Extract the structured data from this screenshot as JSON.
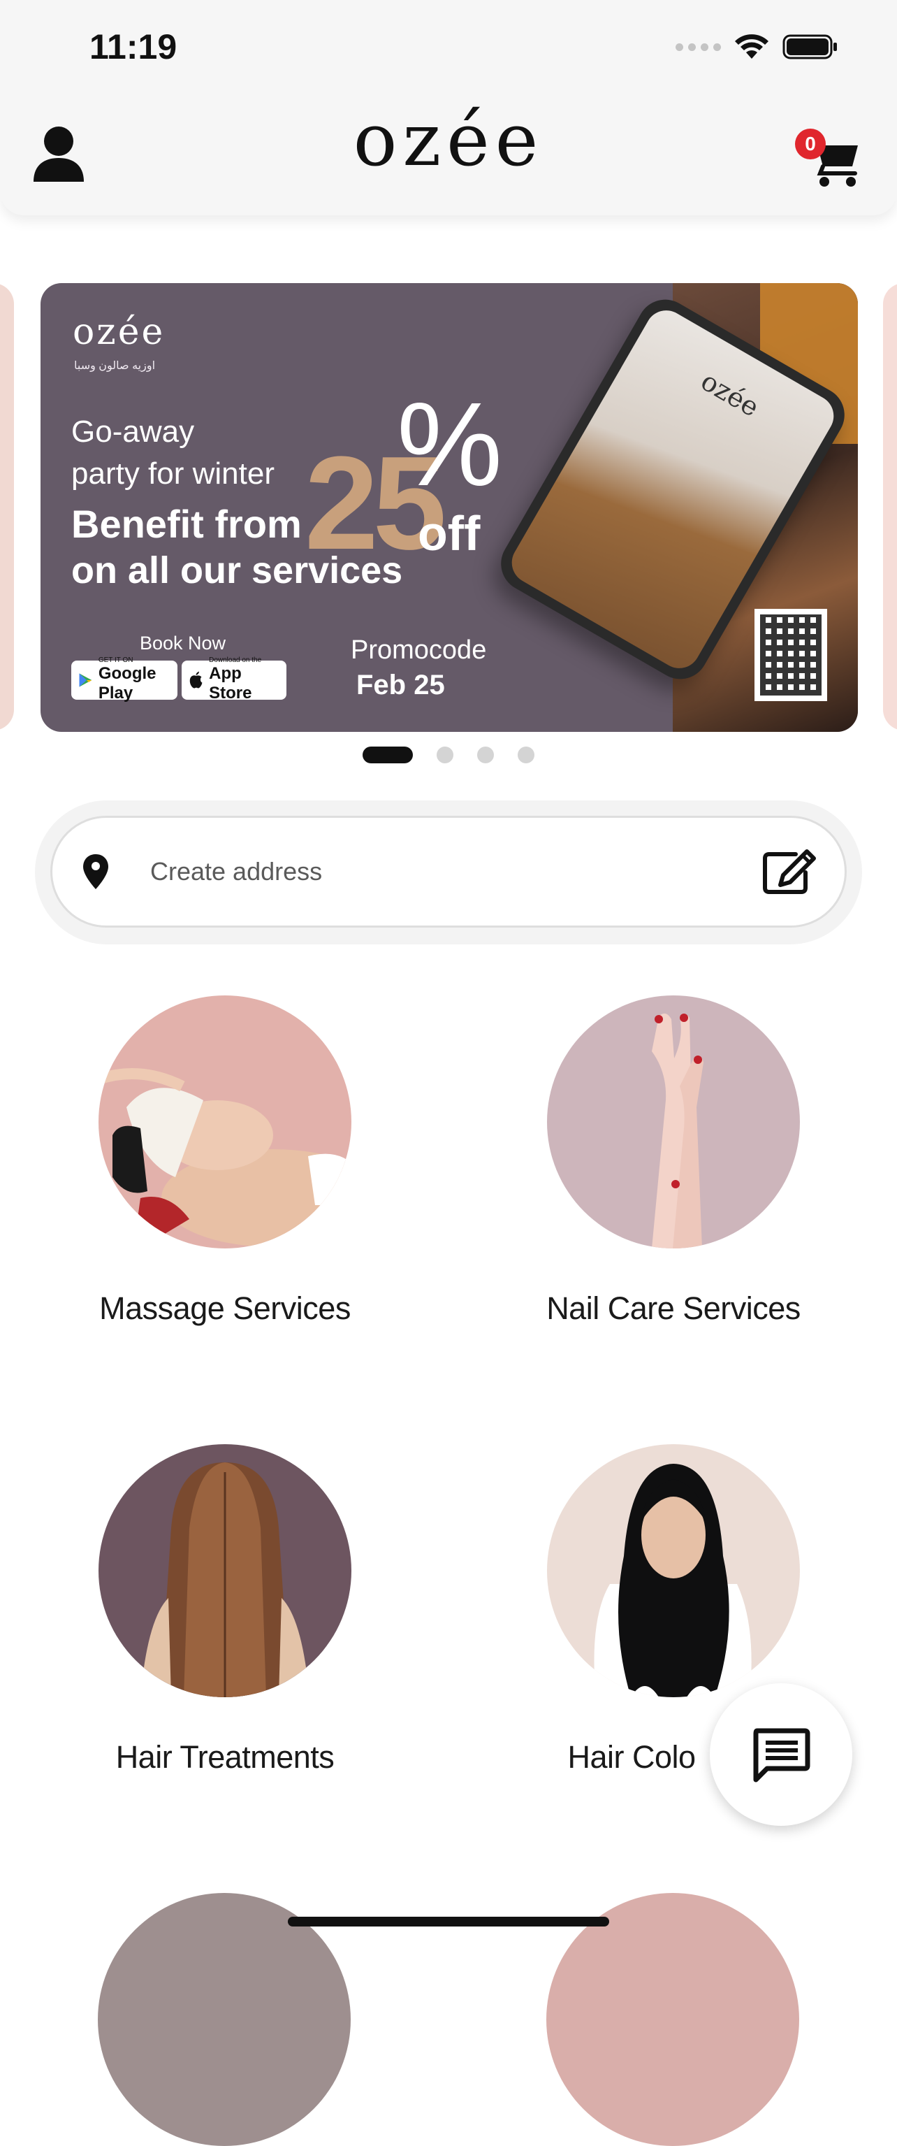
{
  "status_bar": {
    "time": "11:19"
  },
  "header": {
    "logo": "ozée",
    "cart_count": "0"
  },
  "banner": {
    "logo": "ozée",
    "logo_sub": "اوزيه صالون وسبا",
    "line1": "Go-away",
    "line2": "party for winter",
    "line3": "Benefit from",
    "line4": "on all our services",
    "discount_number": "25",
    "discount_percent": "%",
    "discount_off": "off",
    "book_now": "Book Now",
    "google_play_small": "GET IT ON",
    "google_play_label": "Google Play",
    "app_store_small": "Download on the",
    "app_store_label": "App Store",
    "promo_label": "Promocode",
    "promo_code": "Feb 25",
    "phone_logo": "ozée"
  },
  "carousel": {
    "page_count": 4,
    "active_index": 0
  },
  "address": {
    "placeholder": "Create address"
  },
  "categories": [
    {
      "label": "Massage Services",
      "color": "#e2b1ab"
    },
    {
      "label": "Nail Care Services",
      "color": "#cdb5bb"
    },
    {
      "label": "Hair Treatments",
      "color": "#6d5560"
    },
    {
      "label": "Hair Colo",
      "color": "#ecddd6"
    }
  ],
  "icons": {
    "profile": "user-icon",
    "cart": "cart-icon",
    "pin": "location-pin-icon",
    "edit": "edit-icon",
    "chat": "chat-icon"
  }
}
